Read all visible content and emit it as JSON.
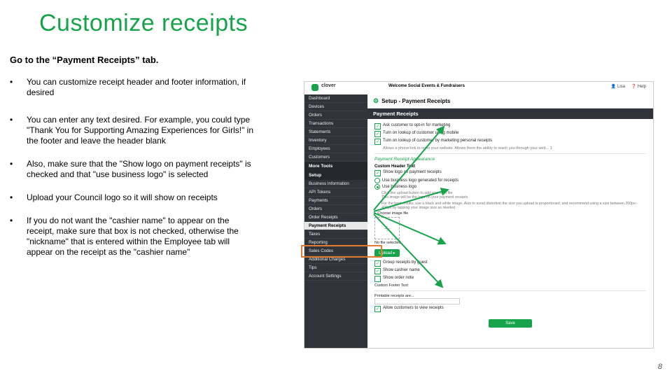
{
  "title": "Customize receipts",
  "instruction": "Go to the “Payment Receipts” tab.",
  "bullets": [
    "You can customize receipt header and footer information, if desired",
    "You can enter any text desired. For example, you could type \"Thank You for Supporting Amazing Experiences for Girls!\" in the footer and leave the header blank",
    "Also, make sure that the \"Show logo on payment receipts\" is checked and that \"use business logo\" is selected",
    "Upload your Council logo so it will show on receipts",
    "If you do not want the \"cashier name\" to appear on the receipt, make sure that box is not checked, otherwise the \"nickname\" that is entered within the Employee tab will appear on the receipt as the \"cashier name\""
  ],
  "bullet_gaps": [
    24,
    18,
    18,
    18,
    0
  ],
  "page_num": "8",
  "shot": {
    "brand": "clover",
    "welcome": "Welcome Social Events & Fundraisers",
    "top_right_1": "Lisa",
    "top_right_2": "Help",
    "page_title": "Setup - Payment Receipts",
    "panel_title": "Payment Receipts",
    "sidebar_top": [
      "Dashboard",
      "Devices",
      "Orders"
    ],
    "sidebar_more": [
      "Transactions",
      "Statements",
      "Inventory",
      "Employees",
      "Customers"
    ],
    "sidebar_section1": "More Tools",
    "sidebar_section2": "Setup",
    "setup_items": [
      "Business Information",
      "API Tokens",
      "Payments",
      "Orders",
      "Order Receipts"
    ],
    "setup_selected": "Payment Receipts",
    "setup_after": [
      "Taxes",
      "Reporting",
      "Sales Codes",
      "Additional Charges",
      "Tips",
      "Account Settings"
    ],
    "checks": [
      {
        "chk": "✓",
        "label": "Ask customer to opt-in for marketing",
        "sub": ""
      },
      {
        "chk": "✓",
        "label": "Turn on lookup of customer using mobile",
        "sub": ""
      },
      {
        "chk": "✓",
        "label": "Turn on lookup of customer by marketing personal receipts",
        "sub": "Allows a phone-link to open your website. Allows them the ability to reach you through your web...  1"
      }
    ],
    "appearance": "Payment Receipt Appearance",
    "custom_header": "Custom Header Text",
    "logo_label": "Show logo on payment receipts",
    "radios": [
      "Use business logo generated for receipts",
      "Use business logo"
    ],
    "tiny1": "Click the upload button to add your own file",
    "tiny2": "This image will be the logo on your payment receipts",
    "tiny3": "For the best results, use a black and white image. Also to avoid distortion the size you upload is proportioned, and recommend using a size between 200px-400px by tapping your image size as needed",
    "choose": "Choose image file",
    "no_file": "No file selected",
    "upload": "Upload  ▸",
    "group": "Group receipts by guest",
    "cashier": "Show cashier name",
    "order_note": "Show order note",
    "custom_footer_txt": "Custom Footer Text",
    "printable": "Printable receipts are...",
    "printable2": "Allow customers to view receipts",
    "save": "Save"
  }
}
